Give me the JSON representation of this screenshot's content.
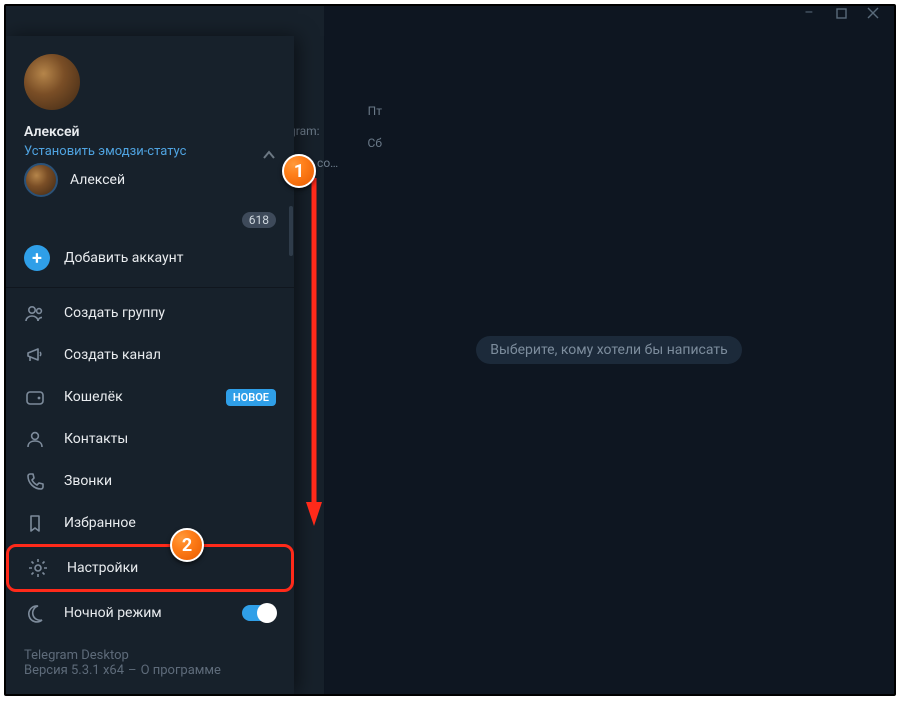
{
  "window": {
    "minimize": "–",
    "maximize": "□",
    "close": "✕"
  },
  "profile": {
    "name": "Алексей",
    "status_link": "Установить эмодзи-статус"
  },
  "accounts": {
    "peek_name": "Алексей",
    "badge": "618",
    "add_label": "Добавить аккаунт"
  },
  "menu": {
    "group": "Создать группу",
    "channel": "Создать канал",
    "wallet": "Кошелёк",
    "wallet_badge": "НОВОЕ",
    "contacts": "Контакты",
    "calls": "Звонки",
    "saved": "Избранное",
    "settings": "Настройки",
    "night": "Ночной режим"
  },
  "footer": {
    "app": "Telegram Desktop",
    "version": "Версия 5.3.1 x64",
    "about": "О программе"
  },
  "chatstrip": {
    "r1_time": "Сб",
    "r1_sub": "вым со…",
    "r2_time": "Пт",
    "r2_sub": "gram:"
  },
  "placeholder": "Выберите, кому хотели бы написать",
  "annotations": {
    "one": "1",
    "two": "2"
  }
}
